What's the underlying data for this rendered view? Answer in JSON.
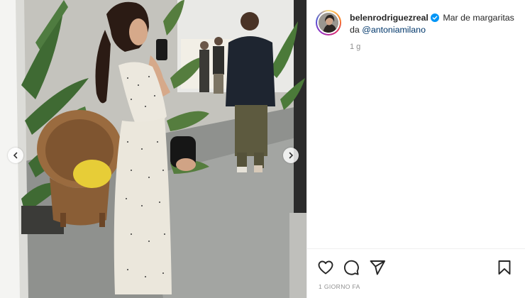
{
  "post": {
    "username": "belenrodriguezreal",
    "caption_text": "Mar de margaritas da ",
    "mention": "@antoniamilano",
    "comment_time": "1 g",
    "post_date": "1 GIORNO FA",
    "verified": true
  },
  "media": {
    "description": "woman in white polka dot dress taking mirror selfie in plant-filled showroom",
    "has_prev": true,
    "has_next": true
  },
  "actions": {
    "like": "heart-icon",
    "comment": "comment-bubble-icon",
    "share": "paper-plane-icon",
    "save": "bookmark-icon"
  },
  "colors": {
    "mention": "#00376b",
    "muted": "#8e8e8e",
    "verified": "#0095f6",
    "text": "#262626"
  }
}
